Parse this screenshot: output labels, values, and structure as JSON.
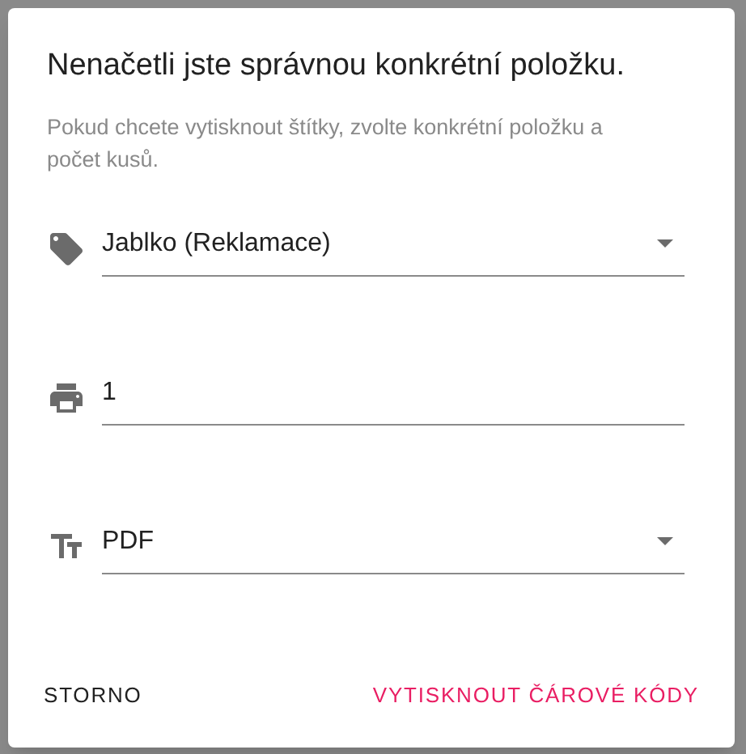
{
  "dialog": {
    "title": "Nenačetli jste správnou konkrétní položku.",
    "description": "Pokud chcete vytisknout štítky, zvolte konkrétní položku a počet kusů.",
    "fields": [
      {
        "kind": "select",
        "value": "Jablko (Reklamace)"
      },
      {
        "kind": "input",
        "value": "1"
      },
      {
        "kind": "select",
        "value": "PDF"
      }
    ],
    "buttons": [
      {
        "label": "STORNO",
        "primary": false
      },
      {
        "label": "VYTISKNOUT ČÁROVÉ KÓDY",
        "primary": true
      }
    ]
  }
}
